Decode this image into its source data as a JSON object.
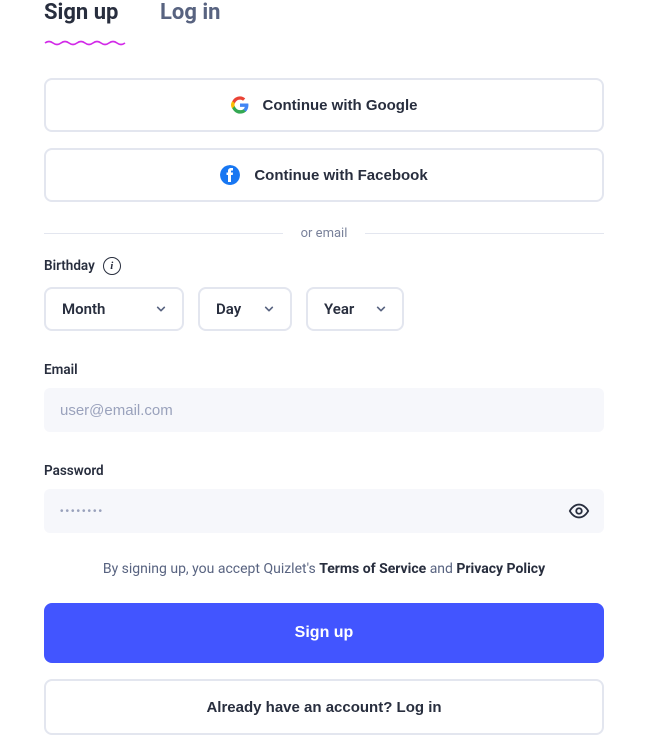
{
  "tabs": {
    "signup": "Sign up",
    "login": "Log in"
  },
  "social": {
    "google": "Continue with Google",
    "facebook": "Continue with Facebook"
  },
  "divider": "or email",
  "birthday": {
    "label": "Birthday",
    "month": "Month",
    "day": "Day",
    "year": "Year"
  },
  "email": {
    "label": "Email",
    "placeholder": "user@email.com",
    "value": ""
  },
  "password": {
    "label": "Password",
    "placeholder": "••••••••",
    "value": ""
  },
  "legal": {
    "prefix": "By signing up, you accept Quizlet's ",
    "tos": "Terms of Service",
    "mid": " and ",
    "privacy": "Privacy Policy"
  },
  "cta": "Sign up",
  "alt_cta": "Already have an account? Log in"
}
